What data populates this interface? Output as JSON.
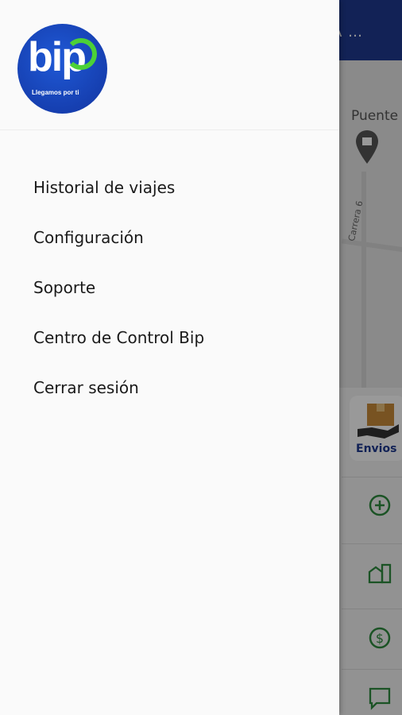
{
  "background": {
    "topbar_text": "A …",
    "map_label": "Puente",
    "street_label": "Carrera 6",
    "envios_label": "Envios",
    "accent": "#1f3a8f",
    "green": "#2e8b3e"
  },
  "drawer": {
    "logo": {
      "word": "bip",
      "slogan": "Llegamos por ti"
    },
    "menu": [
      {
        "label": "Historial de viajes"
      },
      {
        "label": "Configuración"
      },
      {
        "label": "Soporte"
      },
      {
        "label": "Centro de Control Bip"
      },
      {
        "label": "Cerrar sesión"
      }
    ]
  }
}
